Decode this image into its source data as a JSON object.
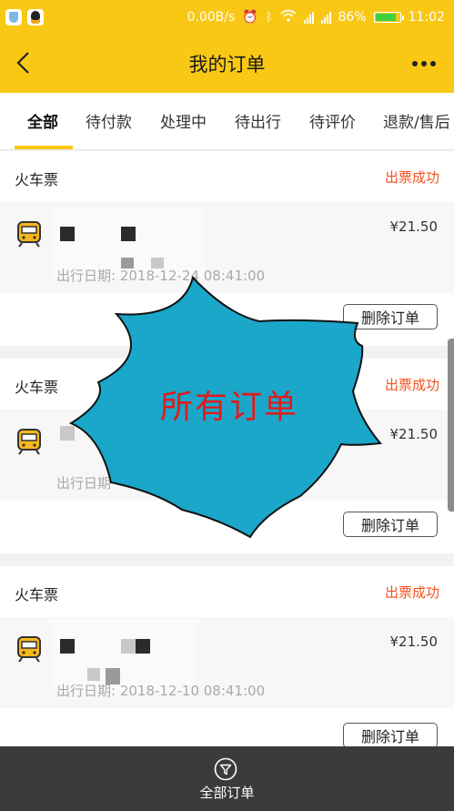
{
  "status_bar": {
    "network_speed": "0.00B/s",
    "battery": "86%",
    "battery_level": 0.86,
    "time": "11:02"
  },
  "header": {
    "title": "我的订单",
    "back_icon": "chevron-left-icon",
    "more_icon": "more-dots-icon"
  },
  "tabs": [
    {
      "label": "全部",
      "active": true
    },
    {
      "label": "待付款",
      "active": false
    },
    {
      "label": "处理中",
      "active": false
    },
    {
      "label": "待出行",
      "active": false
    },
    {
      "label": "待评价",
      "active": false
    },
    {
      "label": "退款/售后",
      "active": false
    }
  ],
  "orders": [
    {
      "type": "火车票",
      "status": "出票成功",
      "price": "¥21.50",
      "date": "出行日期: 2018-12-24 08:41:00",
      "action": "删除订单"
    },
    {
      "type": "火车票",
      "status": "出票成功",
      "price": "¥21.50",
      "date": "出行日期",
      "action": "删除订单"
    },
    {
      "type": "火车票",
      "status": "出票成功",
      "price": "¥21.50",
      "date": "出行日期: 2018-12-10 08:41:00",
      "action": "删除订单"
    }
  ],
  "overlay": {
    "text": "所有订单"
  },
  "bottom_bar": {
    "label": "全部订单",
    "icon": "filter-icon"
  },
  "colors": {
    "brand_yellow": "#f8c815",
    "status_orange": "#f4511e",
    "burst_fill": "#1aa7c9",
    "burst_text": "#e21a1a"
  }
}
